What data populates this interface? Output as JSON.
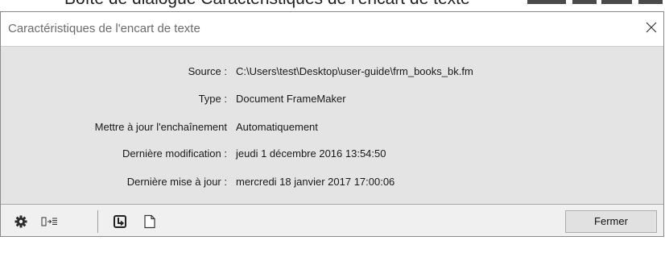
{
  "document": {
    "caption": "Boîte de dialogue Caractéristiques de l'encart de texte"
  },
  "dialog": {
    "title": "Caractéristiques de l'encart de texte",
    "fields": [
      {
        "label": "Source :",
        "value": "C:\\Users\\test\\Desktop\\user-guide\\frm_books_bk.fm"
      },
      {
        "label": "Type :",
        "value": "Document FrameMaker"
      },
      {
        "label": "Mettre à jour l'enchaînement",
        "value": "Automatiquement"
      },
      {
        "label": "Dernière modification :",
        "value": "jeudi 1 décembre 2016 13:54:50"
      },
      {
        "label": "Dernière mise à jour :",
        "value": "mercredi 18 janvier 2017 17:00:06"
      }
    ],
    "toolbar_icons": [
      "gear-icon",
      "link-arrow-icon",
      "update-icon",
      "document-icon"
    ],
    "close_label": "Fermer"
  },
  "colors": {
    "content_bg": "#e4e4e4",
    "footer_bg": "#f0f0f0",
    "title_text": "#6b6b6b"
  }
}
